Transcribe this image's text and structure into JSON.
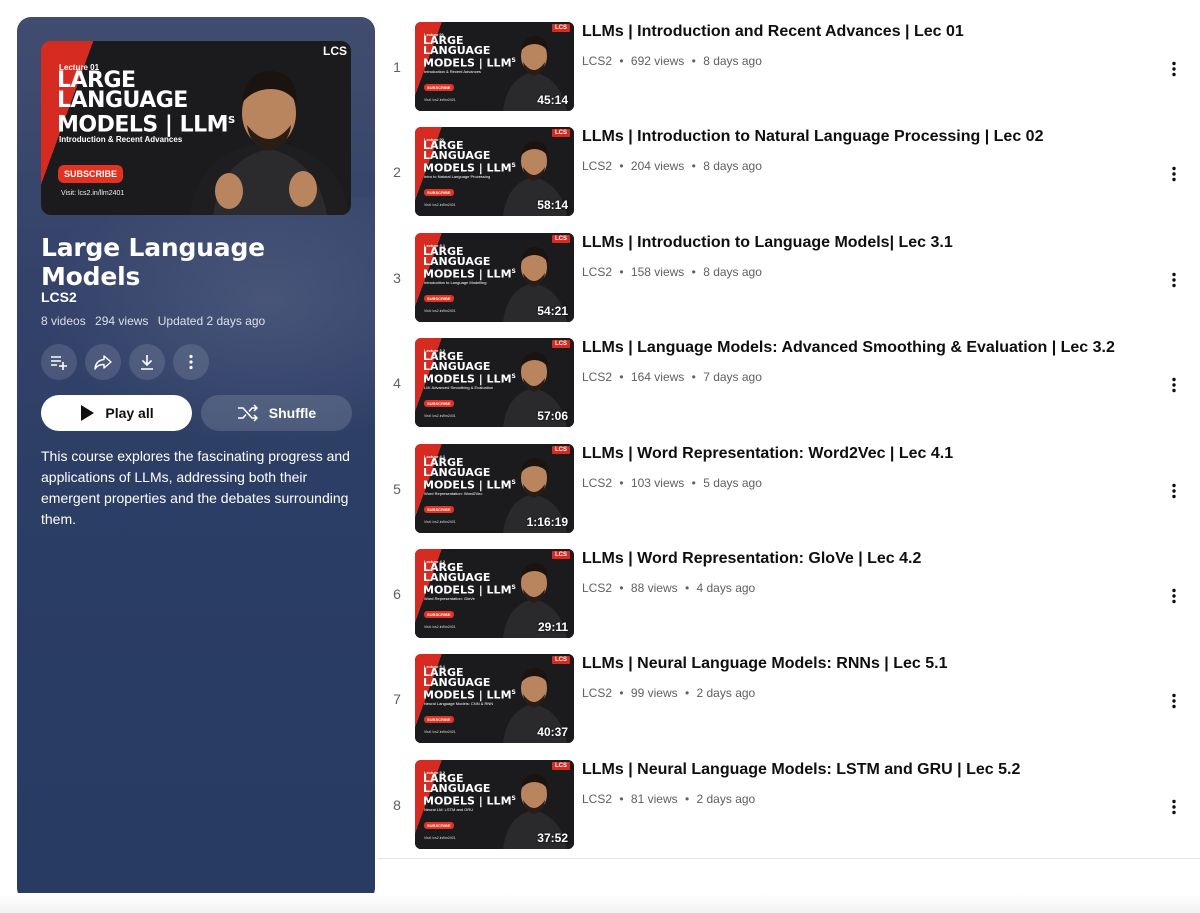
{
  "playlist": {
    "title": "Large Language Models",
    "channel": "LCS2",
    "video_count": "8 videos",
    "views": "294 views",
    "updated": "Updated 2 days ago",
    "description": "This course explores the fascinating progress and applications of LLMs, addressing both their emergent properties and the debates surrounding them.",
    "play_all_label": "Play all",
    "shuffle_label": "Shuffle",
    "actions": [
      "add-to-queue-icon",
      "share-icon",
      "download-icon",
      "more-vert-icon"
    ],
    "cover": {
      "lecture": "Lecture 01",
      "line1": "LARGE",
      "line2": "LANGUAGE",
      "line3": "MODELS | LLM",
      "superscript": "S",
      "subtitle": "Introduction & Recent Advances",
      "subscribe": "SUBSCRIBE",
      "visit": "Visit: lcs2.in/llm2401",
      "logo": "LCS"
    }
  },
  "thumb_common": {
    "line1": "LARGE",
    "line2": "LANGUAGE",
    "line3": "MODELS | LLM",
    "superscript": "S",
    "subscribe": "SUBSCRIBE",
    "visit": "Visit: lcs2.in/llm2401",
    "logo": "LCS"
  },
  "videos": [
    {
      "index": "1",
      "title": "LLMs | Introduction and Recent Advances | Lec 01",
      "channel": "LCS2",
      "views": "692 views",
      "age": "8 days ago",
      "duration": "45:14",
      "lecture": "Lecture 01",
      "subtitle": "Introduction & Recent Advances"
    },
    {
      "index": "2",
      "title": "LLMs | Introduction to Natural Language Processing | Lec 02",
      "channel": "LCS2",
      "views": "204 views",
      "age": "8 days ago",
      "duration": "58:14",
      "lecture": "Lecture 02",
      "subtitle": "Intro to Natural Language Processing"
    },
    {
      "index": "3",
      "title": "LLMs | Introduction to Language Models| Lec 3.1",
      "channel": "LCS2",
      "views": "158 views",
      "age": "8 days ago",
      "duration": "54:21",
      "lecture": "Lecture 3.1",
      "subtitle": "Introduction to Language Modelling"
    },
    {
      "index": "4",
      "title": "LLMs | Language Models: Advanced Smoothing & Evaluation | Lec 3.2",
      "channel": "LCS2",
      "views": "164 views",
      "age": "7 days ago",
      "duration": "57:06",
      "lecture": "Lecture 3.2",
      "subtitle": "LM: Advanced Smoothing & Evaluation"
    },
    {
      "index": "5",
      "title": "LLMs | Word Representation: Word2Vec | Lec 4.1",
      "channel": "LCS2",
      "views": "103 views",
      "age": "5 days ago",
      "duration": "1:16:19",
      "lecture": "Lecture 4.1",
      "subtitle": "Word Representation: Word2Vec"
    },
    {
      "index": "6",
      "title": "LLMs | Word Representation: GloVe | Lec 4.2",
      "channel": "LCS2",
      "views": "88 views",
      "age": "4 days ago",
      "duration": "29:11",
      "lecture": "Lecture 4.2",
      "subtitle": "Word Representation: GloVe"
    },
    {
      "index": "7",
      "title": "LLMs | Neural Language Models: RNNs | Lec 5.1",
      "channel": "LCS2",
      "views": "99 views",
      "age": "2 days ago",
      "duration": "40:37",
      "lecture": "Lecture 5.1",
      "subtitle": "Neural Language Models: CNN & RNN"
    },
    {
      "index": "8",
      "title": "LLMs | Neural Language Models: LSTM and GRU | Lec 5.2",
      "channel": "LCS2",
      "views": "81 views",
      "age": "2 days ago",
      "duration": "37:52",
      "lecture": "Lecture 5.2",
      "subtitle": "Neural LM: LSTM and GRU"
    }
  ],
  "colors": {
    "panel": "#2f4068",
    "accent_red": "#d62c22",
    "meta_gray": "#606060"
  }
}
